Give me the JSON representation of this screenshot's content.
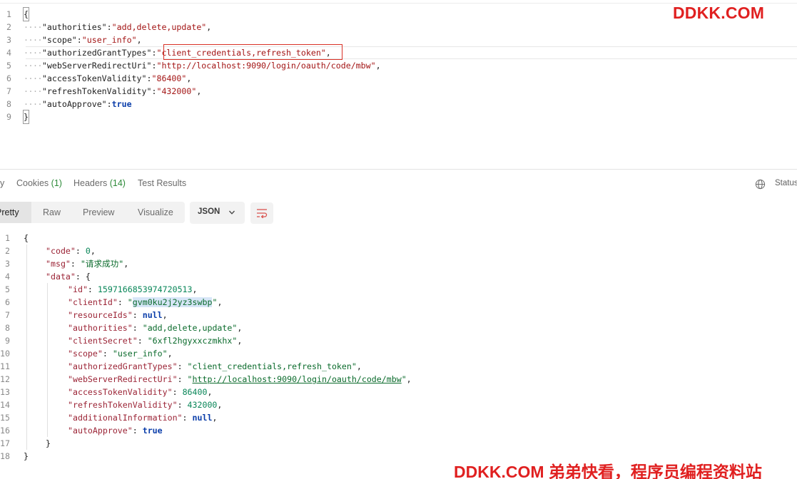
{
  "request_body": {
    "lines": [
      {
        "n": "1",
        "dots": "",
        "parts": [
          {
            "t": "{",
            "c": "brace"
          }
        ]
      },
      {
        "n": "2",
        "dots": "····",
        "parts": [
          {
            "t": "\"authorities\"",
            "c": "key"
          },
          {
            "t": ":",
            "c": "p"
          },
          {
            "t": "\"add,delete,update\"",
            "c": "str"
          },
          {
            "t": ",",
            "c": "p"
          }
        ]
      },
      {
        "n": "3",
        "dots": "····",
        "parts": [
          {
            "t": "\"scope\"",
            "c": "key"
          },
          {
            "t": ":",
            "c": "p"
          },
          {
            "t": "\"user_info\"",
            "c": "str"
          },
          {
            "t": ",",
            "c": "p"
          }
        ]
      },
      {
        "n": "4",
        "dots": "····",
        "parts": [
          {
            "t": "\"authorizedGrantTypes\"",
            "c": "key"
          },
          {
            "t": ":",
            "c": "p"
          },
          {
            "t": "\"client_credentials,refresh_token\"",
            "c": "str"
          },
          {
            "t": ",",
            "c": "p"
          }
        ]
      },
      {
        "n": "5",
        "dots": "····",
        "parts": [
          {
            "t": "\"webServerRedirectUri\"",
            "c": "key"
          },
          {
            "t": ":",
            "c": "p"
          },
          {
            "t": "\"http://localhost:9090/login/oauth/code/mbw\"",
            "c": "str"
          },
          {
            "t": ",",
            "c": "p"
          }
        ]
      },
      {
        "n": "6",
        "dots": "····",
        "parts": [
          {
            "t": "\"accessTokenValidity\"",
            "c": "key"
          },
          {
            "t": ":",
            "c": "p"
          },
          {
            "t": "\"86400\"",
            "c": "str"
          },
          {
            "t": ",",
            "c": "p"
          }
        ]
      },
      {
        "n": "7",
        "dots": "····",
        "parts": [
          {
            "t": "\"refreshTokenValidity\"",
            "c": "key"
          },
          {
            "t": ":",
            "c": "p"
          },
          {
            "t": "\"432000\"",
            "c": "str"
          },
          {
            "t": ",",
            "c": "p"
          }
        ]
      },
      {
        "n": "8",
        "dots": "····",
        "parts": [
          {
            "t": "\"autoApprove\"",
            "c": "key"
          },
          {
            "t": ":",
            "c": "p"
          },
          {
            "t": "true",
            "c": "bool"
          }
        ]
      },
      {
        "n": "9",
        "dots": "",
        "parts": [
          {
            "t": "}",
            "c": "brace"
          }
        ]
      }
    ]
  },
  "watermark_top": "DDKK.COM",
  "response_tabs": [
    {
      "label": "y",
      "count": ""
    },
    {
      "label": "Cookies",
      "count": "(1)"
    },
    {
      "label": "Headers",
      "count": "(14)"
    },
    {
      "label": "Test Results",
      "count": ""
    }
  ],
  "status_label": "Status",
  "view_modes": [
    "Pretty",
    "Raw",
    "Preview",
    "Visualize"
  ],
  "active_view_mode": "Pretty",
  "format_selected": "JSON",
  "response_body": {
    "lines": [
      {
        "n": "1",
        "indent": 0,
        "parts": [
          {
            "t": "{",
            "c": "p"
          }
        ]
      },
      {
        "n": "2",
        "indent": 1,
        "parts": [
          {
            "t": "\"code\"",
            "c": "key"
          },
          {
            "t": ": ",
            "c": "p"
          },
          {
            "t": "0",
            "c": "num"
          },
          {
            "t": ",",
            "c": "p"
          }
        ]
      },
      {
        "n": "3",
        "indent": 1,
        "parts": [
          {
            "t": "\"msg\"",
            "c": "key"
          },
          {
            "t": ": ",
            "c": "p"
          },
          {
            "t": "\"请求成功\"",
            "c": "str"
          },
          {
            "t": ",",
            "c": "p"
          }
        ]
      },
      {
        "n": "4",
        "indent": 1,
        "parts": [
          {
            "t": "\"data\"",
            "c": "key"
          },
          {
            "t": ": {",
            "c": "p"
          }
        ]
      },
      {
        "n": "5",
        "indent": 2,
        "parts": [
          {
            "t": "\"id\"",
            "c": "key"
          },
          {
            "t": ": ",
            "c": "p"
          },
          {
            "t": "1597166853974720513",
            "c": "num"
          },
          {
            "t": ",",
            "c": "p"
          }
        ]
      },
      {
        "n": "6",
        "indent": 2,
        "parts": [
          {
            "t": "\"clientId\"",
            "c": "key"
          },
          {
            "t": ": ",
            "c": "p"
          },
          {
            "t": "\"",
            "c": "str"
          },
          {
            "t": "gvm0ku2j2yz3swbp",
            "c": "sel"
          },
          {
            "t": "\"",
            "c": "str"
          },
          {
            "t": ",",
            "c": "p"
          }
        ]
      },
      {
        "n": "7",
        "indent": 2,
        "parts": [
          {
            "t": "\"resourceIds\"",
            "c": "key"
          },
          {
            "t": ": ",
            "c": "p"
          },
          {
            "t": "null",
            "c": "kw"
          },
          {
            "t": ",",
            "c": "p"
          }
        ]
      },
      {
        "n": "8",
        "indent": 2,
        "parts": [
          {
            "t": "\"authorities\"",
            "c": "key"
          },
          {
            "t": ": ",
            "c": "p"
          },
          {
            "t": "\"add,delete,update\"",
            "c": "str"
          },
          {
            "t": ",",
            "c": "p"
          }
        ]
      },
      {
        "n": "9",
        "indent": 2,
        "parts": [
          {
            "t": "\"clientSecret\"",
            "c": "key"
          },
          {
            "t": ": ",
            "c": "p"
          },
          {
            "t": "\"6xfl2hgyxxczmkhx\"",
            "c": "str"
          },
          {
            "t": ",",
            "c": "p"
          }
        ]
      },
      {
        "n": "10",
        "indent": 2,
        "parts": [
          {
            "t": "\"scope\"",
            "c": "key"
          },
          {
            "t": ": ",
            "c": "p"
          },
          {
            "t": "\"user_info\"",
            "c": "str"
          },
          {
            "t": ",",
            "c": "p"
          }
        ]
      },
      {
        "n": "11",
        "indent": 2,
        "parts": [
          {
            "t": "\"authorizedGrantTypes\"",
            "c": "key"
          },
          {
            "t": ": ",
            "c": "p"
          },
          {
            "t": "\"client_credentials,refresh_token\"",
            "c": "str"
          },
          {
            "t": ",",
            "c": "p"
          }
        ]
      },
      {
        "n": "12",
        "indent": 2,
        "parts": [
          {
            "t": "\"webServerRedirectUri\"",
            "c": "key"
          },
          {
            "t": ": ",
            "c": "p"
          },
          {
            "t": "\"",
            "c": "str"
          },
          {
            "t": "http://localhost:9090/login/oauth/code/mbw",
            "c": "link"
          },
          {
            "t": "\"",
            "c": "str"
          },
          {
            "t": ",",
            "c": "p"
          }
        ]
      },
      {
        "n": "13",
        "indent": 2,
        "parts": [
          {
            "t": "\"accessTokenValidity\"",
            "c": "key"
          },
          {
            "t": ": ",
            "c": "p"
          },
          {
            "t": "86400",
            "c": "num"
          },
          {
            "t": ",",
            "c": "p"
          }
        ]
      },
      {
        "n": "14",
        "indent": 2,
        "parts": [
          {
            "t": "\"refreshTokenValidity\"",
            "c": "key"
          },
          {
            "t": ": ",
            "c": "p"
          },
          {
            "t": "432000",
            "c": "num"
          },
          {
            "t": ",",
            "c": "p"
          }
        ]
      },
      {
        "n": "15",
        "indent": 2,
        "parts": [
          {
            "t": "\"additionalInformation\"",
            "c": "key"
          },
          {
            "t": ": ",
            "c": "p"
          },
          {
            "t": "null",
            "c": "kw"
          },
          {
            "t": ",",
            "c": "p"
          }
        ]
      },
      {
        "n": "16",
        "indent": 2,
        "parts": [
          {
            "t": "\"autoApprove\"",
            "c": "key"
          },
          {
            "t": ": ",
            "c": "p"
          },
          {
            "t": "true",
            "c": "kw"
          }
        ]
      },
      {
        "n": "17",
        "indent": 1,
        "parts": [
          {
            "t": "}",
            "c": "p"
          }
        ]
      },
      {
        "n": "18",
        "indent": 0,
        "parts": [
          {
            "t": "}",
            "c": "p"
          }
        ]
      }
    ]
  },
  "watermark_bottom": "DDKK.COM 弟弟快看，程序员编程资料站",
  "colors": {
    "accent_red": "#e02020",
    "count_green": "#2e8b3a",
    "highlight_box": "#d93025"
  }
}
